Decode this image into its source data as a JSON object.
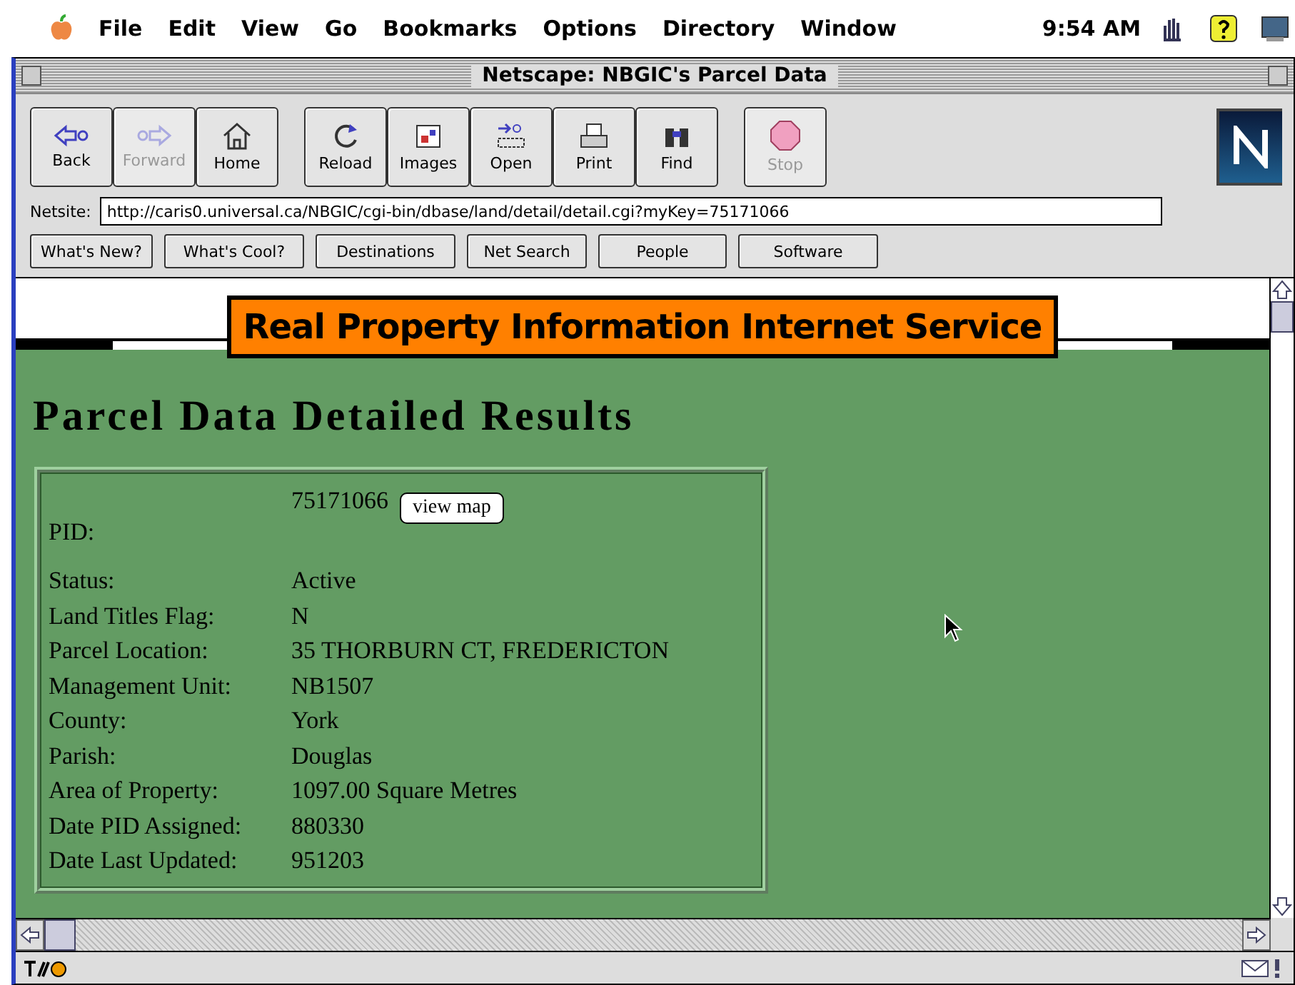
{
  "menu_bar": {
    "items": [
      "File",
      "Edit",
      "View",
      "Go",
      "Bookmarks",
      "Options",
      "Directory",
      "Window"
    ],
    "clock": "9:54 AM"
  },
  "window": {
    "title": "Netscape: NBGIC's Parcel Data"
  },
  "toolbar": [
    {
      "label": "Back",
      "kind": "back",
      "disabled": false
    },
    {
      "label": "Forward",
      "kind": "forward",
      "disabled": true
    },
    {
      "label": "Home",
      "kind": "home",
      "disabled": false
    },
    {
      "label": "Reload",
      "kind": "reload",
      "disabled": false
    },
    {
      "label": "Images",
      "kind": "images",
      "disabled": false
    },
    {
      "label": "Open",
      "kind": "open",
      "disabled": false
    },
    {
      "label": "Print",
      "kind": "print",
      "disabled": false
    },
    {
      "label": "Find",
      "kind": "find",
      "disabled": false
    },
    {
      "label": "Stop",
      "kind": "stop",
      "disabled": true
    }
  ],
  "location": {
    "label": "Netsite:",
    "url": "http://caris0.universal.ca/NBGIC/cgi-bin/dbase/land/detail/detail.cgi?myKey=75171066"
  },
  "directory_buttons": [
    "What's New?",
    "What's Cool?",
    "Destinations",
    "Net Search",
    "People",
    "Software"
  ],
  "page": {
    "banner": "Real Property Information Internet Service",
    "heading": "Parcel Data Detailed Results",
    "pid": {
      "label": "PID:",
      "value": "75171066",
      "button": "view map"
    },
    "rows": [
      {
        "label": "Status:",
        "value": "Active"
      },
      {
        "label": "Land Titles Flag:",
        "value": "N"
      },
      {
        "label": "Parcel Location:",
        "value": "35 THORBURN CT, FREDERICTON"
      },
      {
        "label": "Management Unit:",
        "value": "NB1507"
      },
      {
        "label": "County:",
        "value": "York"
      },
      {
        "label": "Parish:",
        "value": "Douglas"
      },
      {
        "label": "Area of Property:",
        "value": "1097.00 Square Metres"
      },
      {
        "label": "Date PID Assigned:",
        "value": "880330"
      },
      {
        "label": "Date Last Updated:",
        "value": "951203"
      }
    ]
  }
}
